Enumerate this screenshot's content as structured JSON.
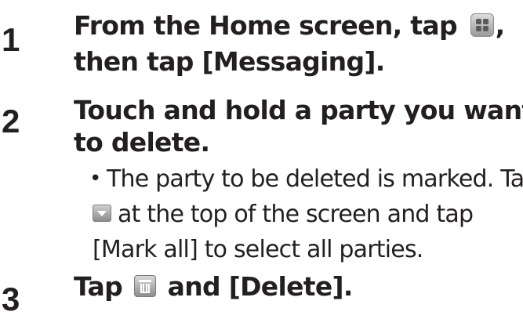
{
  "steps": [
    {
      "number": "1",
      "line1_before_icon": "From the Home screen, tap",
      "line1_after_icon": ",",
      "line2": "then tap [Messaging]."
    },
    {
      "number": "2",
      "line1": "Touch and hold a party you want",
      "line2": "to delete.",
      "bullet": "•",
      "note_line1": "The party to be deleted is marked. Tap",
      "note_line2_after_icon": "at the top of the screen and tap",
      "note_line3": "[Mark all] to select all parties."
    },
    {
      "number": "3",
      "line1_before_icon": "Tap",
      "line1_after_icon": "and [Delete]."
    }
  ],
  "icons": {
    "apps": "apps-grid-icon",
    "dropdown": "dropdown-arrow-icon",
    "trash": "trash-icon"
  }
}
